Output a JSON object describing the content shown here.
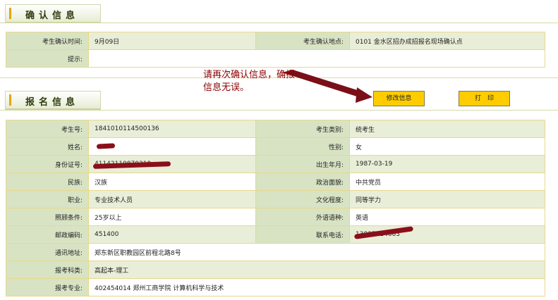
{
  "confirm_section": {
    "title": "确认信息",
    "rows": [
      {
        "label1": "考生确认时间:",
        "value1": "9月09日",
        "label2": "考生确认地点:",
        "value2": "0101  金水区招办成招报名现场确认点"
      },
      {
        "label1": "提示:",
        "value1": ""
      }
    ]
  },
  "annotation": {
    "text": "请再次确认信息，确报信息无误。"
  },
  "registration_section": {
    "title": "报名信息",
    "edit_button": "修改信息",
    "print_button": "打　印",
    "rows": [
      {
        "label1": "考生号:",
        "value1": "1841010114500136",
        "label2": "考生类别:",
        "value2": "统考生"
      },
      {
        "label1": "姓名:",
        "value1": "",
        "label2": "性别:",
        "value2": "女"
      },
      {
        "label1": "身份证号:",
        "value1": "41142119870319",
        "label2": "出生年月:",
        "value2": "1987-03-19"
      },
      {
        "label1": "民族:",
        "value1": "汉族",
        "label2": "政治面貌:",
        "value2": "中共党员"
      },
      {
        "label1": "职业:",
        "value1": "专业技术人员",
        "label2": "文化程度:",
        "value2": "同等学力"
      },
      {
        "label1": "照顾条件:",
        "value1": "25岁以上",
        "label2": "外语语种:",
        "value2": "英语"
      },
      {
        "label1": "邮政编码:",
        "value1": "451400",
        "label2": "联系电话:",
        "value2": "13837414663"
      },
      {
        "label1": "通讯地址:",
        "value1": "郑东新区职教园区前程北路8号"
      },
      {
        "label1": "报考科类:",
        "value1": "高起本-理工"
      },
      {
        "label1": "报考专业:",
        "value1": "402454014  郑州工商学院  计算机科学与技术"
      }
    ]
  },
  "colors": {
    "label_bg": "#d8e3c4",
    "alt_bg": "#e9eed8",
    "button": "#ffcc00",
    "annotation": "#8b0000"
  }
}
